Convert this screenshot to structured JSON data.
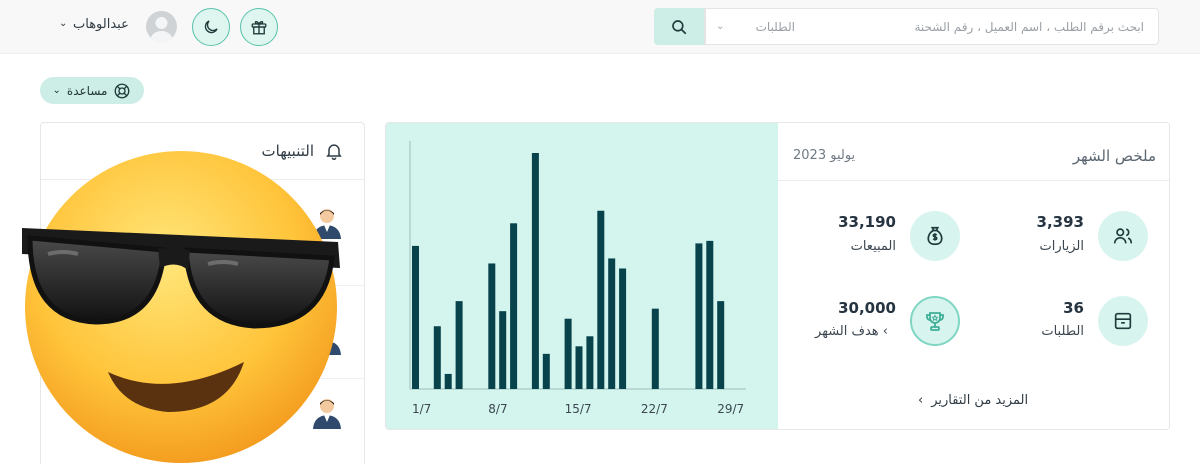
{
  "topbar": {
    "search_placeholder": "ابحث برقم الطلب ، اسم العميل ، رقم الشحنة",
    "search_category": "الطلبات",
    "user_name": "عبدالوهاب"
  },
  "help": {
    "label": "مساعدة"
  },
  "alerts": {
    "title": "التنبيهات"
  },
  "summary": {
    "title": "ملخص الشهر",
    "date": "يوليو 2023",
    "stats": [
      {
        "value": "3,393",
        "label": "الزيارات",
        "icon": "users-icon"
      },
      {
        "value": "33,190",
        "label": "المبيعات",
        "icon": "money-bag-icon"
      },
      {
        "value": "36",
        "label": "الطلبات",
        "icon": "box-icon"
      },
      {
        "value": "30,000",
        "label": "هدف الشهر",
        "icon": "trophy-icon"
      }
    ],
    "more_reports": "المزيد من التقارير"
  },
  "chart_data": {
    "type": "bar",
    "x_tick_labels": [
      "1/7",
      "8/7",
      "15/7",
      "22/7",
      "29/7"
    ],
    "values": [
      57,
      0,
      25,
      6,
      35,
      0,
      0,
      50,
      31,
      66,
      0,
      94,
      14,
      0,
      28,
      17,
      21,
      71,
      52,
      48,
      0,
      0,
      32,
      0,
      0,
      0,
      58,
      59,
      35
    ],
    "bar_color": "#08424b",
    "background": "#d3f5ee"
  },
  "colors": {
    "accent": "#58c3ab",
    "accent_light": "#cdeee6",
    "bar": "#08424b"
  },
  "icons": [
    "search-icon",
    "gift-icon",
    "moon-icon",
    "lifebuoy-icon",
    "bell-icon",
    "sunglasses-emoji"
  ]
}
